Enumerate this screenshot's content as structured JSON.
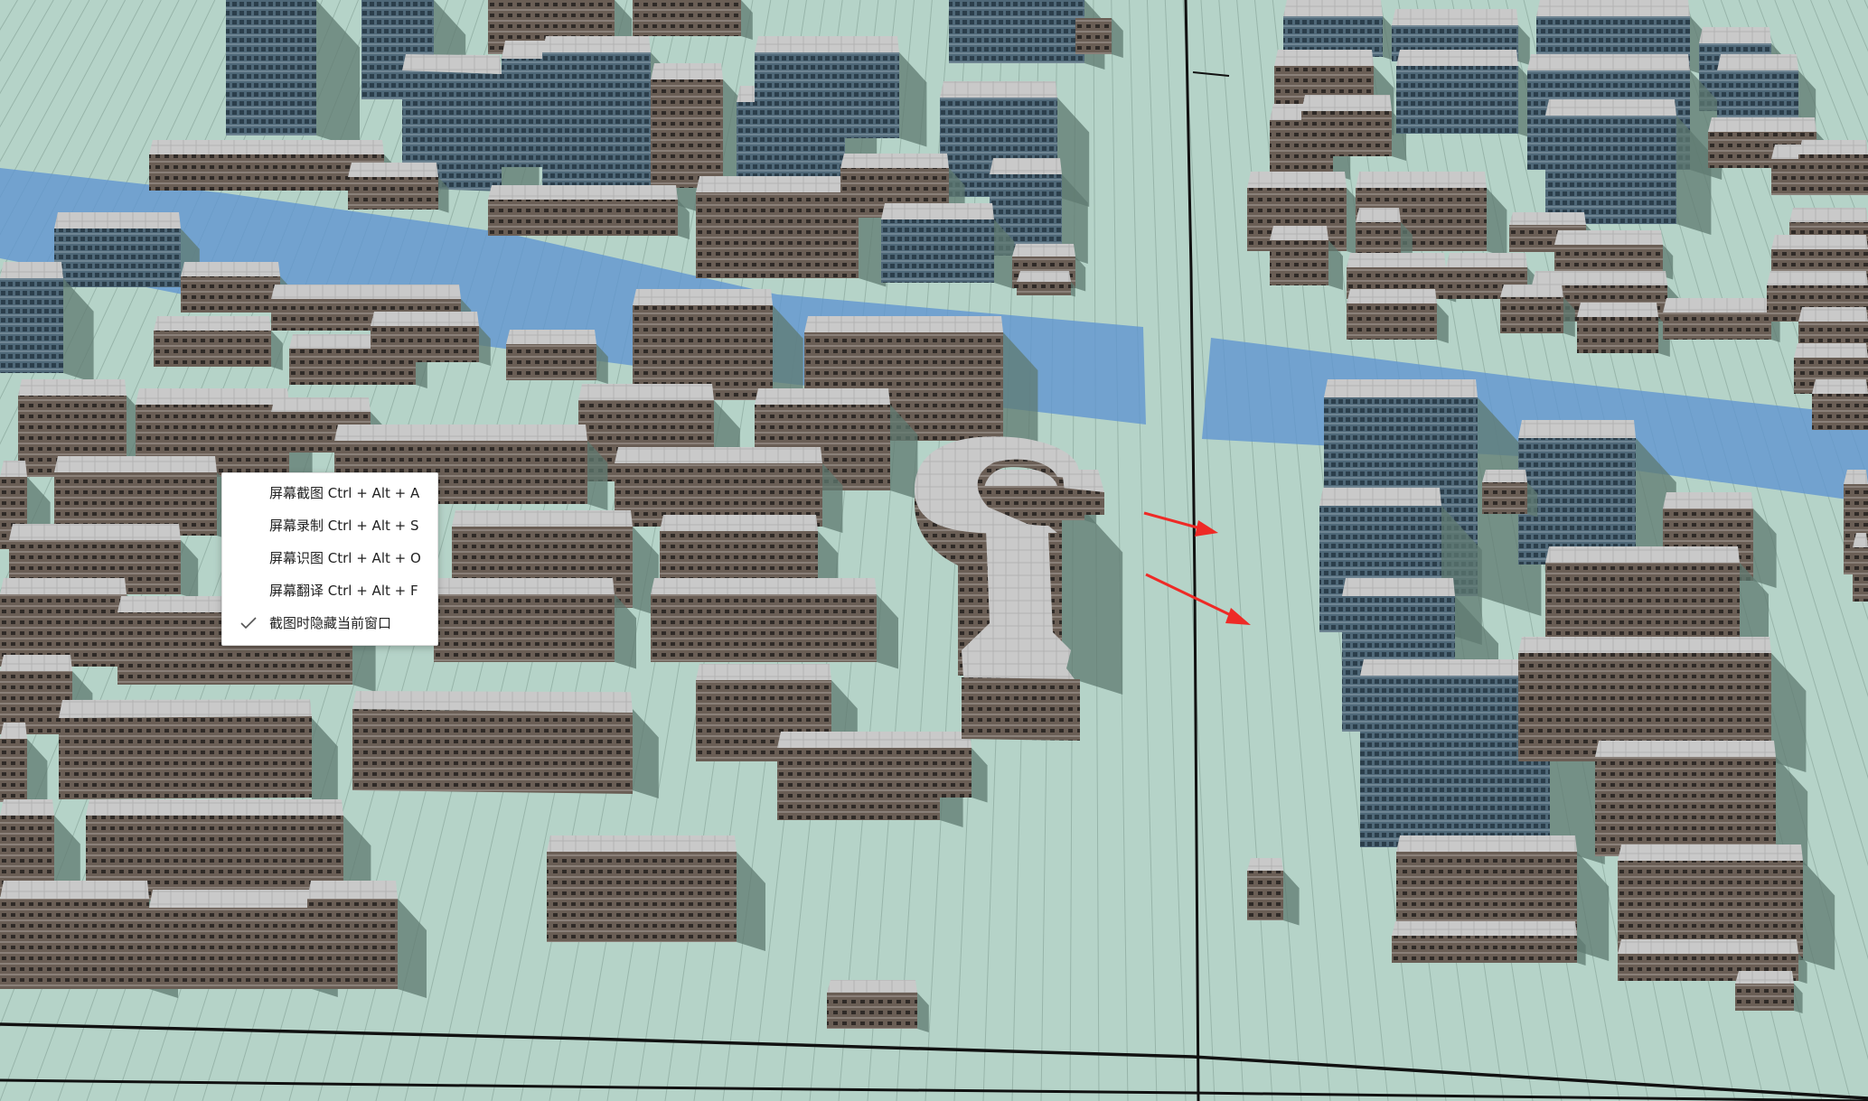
{
  "colors": {
    "ground": "#b5d3c8",
    "grid_line": "#7f9c91",
    "road": "#111111",
    "river": "#5f95d1",
    "roof": "#c9c9c9",
    "roof_dark": "#a9a9a9",
    "facade_warm": "#6a5e55",
    "facade_blue": "#4f6878",
    "shadow": "#5f7a70",
    "arrow": "#ee2a26",
    "menu_bg": "#ffffff",
    "menu_text": "#222222"
  },
  "icons": {
    "checked": "check-icon",
    "arrow": "red-arrow-annotation"
  },
  "context_menu": {
    "items": [
      {
        "label": "屏幕截图 Ctrl + Alt + A",
        "checked": false
      },
      {
        "label": "屏幕录制 Ctrl + Alt + S",
        "checked": false
      },
      {
        "label": "屏幕识图 Ctrl + Alt + O",
        "checked": false
      },
      {
        "label": "屏幕翻译 Ctrl + Alt + F",
        "checked": false
      },
      {
        "label": "截图时隐藏当前窗口",
        "checked": true
      }
    ]
  }
}
